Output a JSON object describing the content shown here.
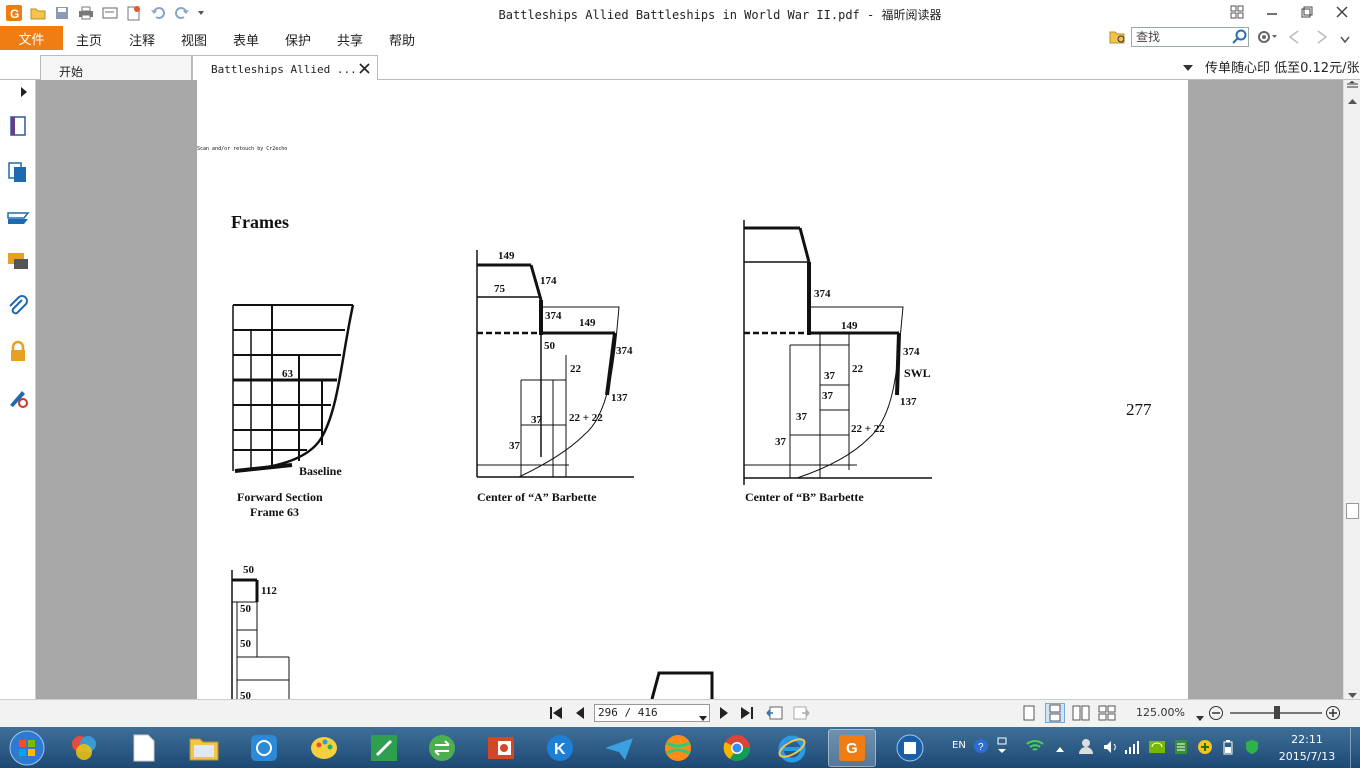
{
  "window": {
    "title": "Battleships Allied Battleships in World War II.pdf - 福昕阅读器"
  },
  "menu": {
    "file": "文件",
    "items": [
      "主页",
      "注释",
      "视图",
      "表单",
      "保护",
      "共享",
      "帮助"
    ]
  },
  "search": {
    "placeholder": "查找"
  },
  "tabs": [
    {
      "label": "开始"
    },
    {
      "label": "Battleships Allied ..."
    }
  ],
  "ad": {
    "text": "传单随心印 低至0.12元/张"
  },
  "document": {
    "scan_note": "Scan and/or retouch by Cr2echo",
    "heading": "Frames",
    "page_number": "277",
    "fig1": {
      "label63": "63",
      "baseline": "Baseline",
      "caption1": "Forward Section",
      "caption2": "Frame 63"
    },
    "fig2": {
      "n149": "149",
      "n174": "174",
      "n75": "75",
      "n374a": "374",
      "n149b": "149",
      "n50": "50",
      "n374b": "374",
      "n22": "22",
      "n137": "137",
      "n37a": "37",
      "n2222": "22 + 22",
      "n37b": "37",
      "caption": "Center of “A” Barbette"
    },
    "fig3": {
      "n374a": "374",
      "n149": "149",
      "n374b": "374",
      "n37a": "37",
      "n22": "22",
      "swl": "SWL",
      "n37b": "37",
      "n137": "137",
      "n37c": "37",
      "n2222": "22 + 22",
      "n37d": "37",
      "caption": "Center of “B” Barbette"
    },
    "fig4": {
      "n50a": "50",
      "n112": "112",
      "n50b": "50",
      "n50c": "50",
      "n50d": "50"
    }
  },
  "status": {
    "page_indicator": "296 / 416",
    "zoom": "125.00%"
  },
  "taskbar": {
    "time": "22:11",
    "date": "2015/7/13",
    "lang": "EN"
  },
  "colors": {
    "accent": "#f07c14",
    "taskbar": "#2a5a85"
  }
}
